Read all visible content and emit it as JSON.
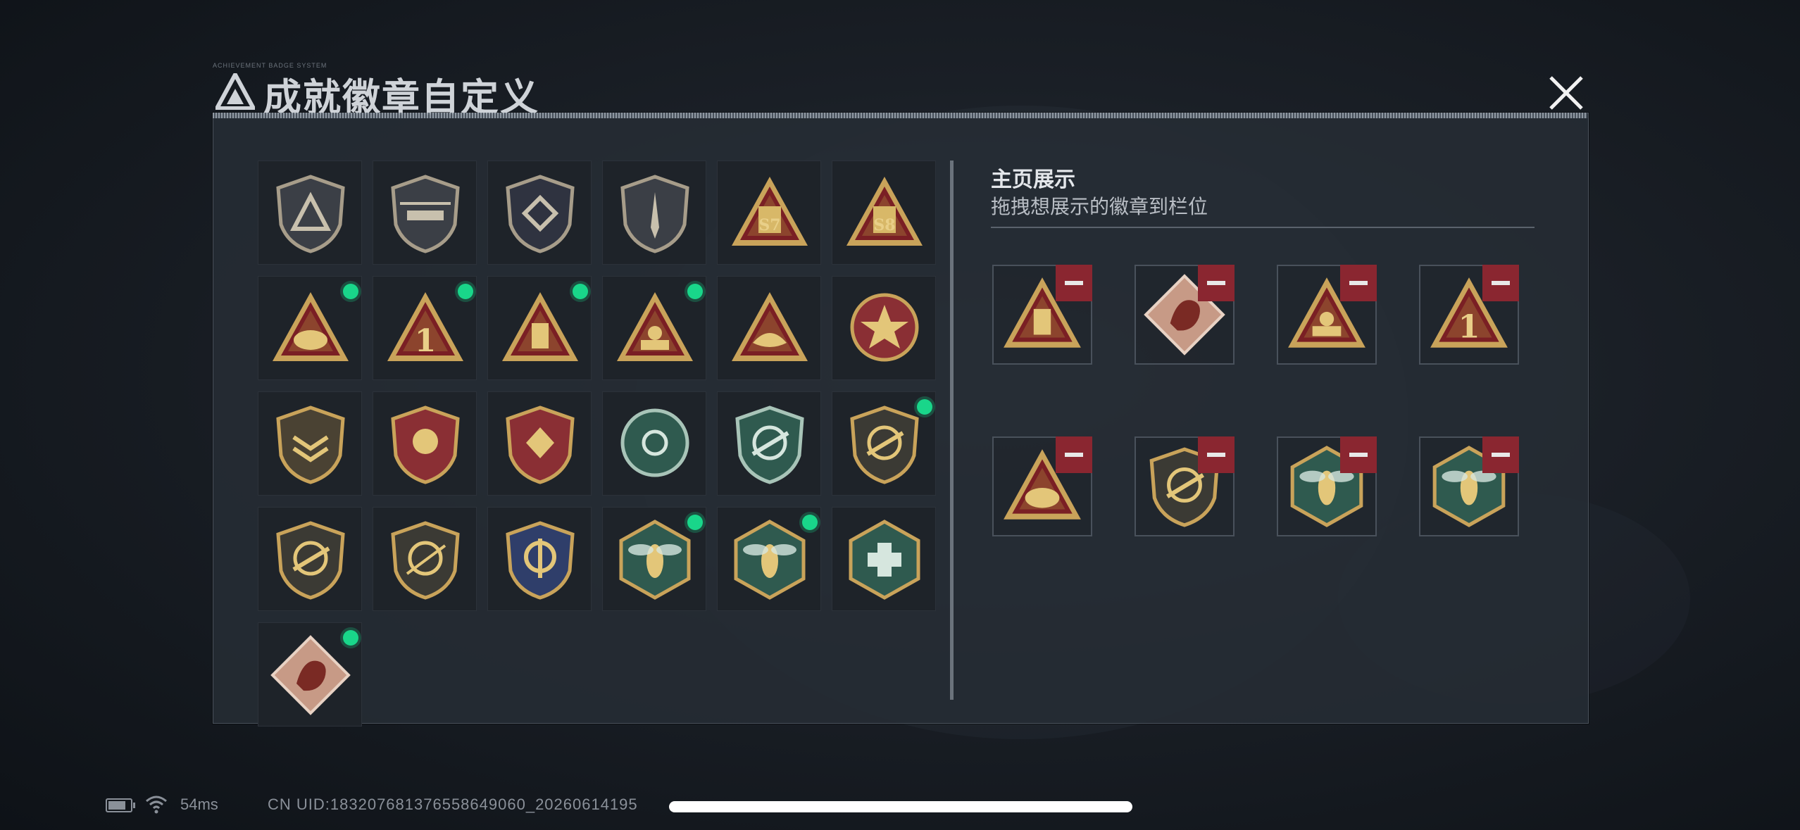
{
  "header": {
    "title": "成就徽章自定义",
    "tiny_label": "ACHIEVEMENT BADGE SYSTEM",
    "close_icon": "close-icon"
  },
  "colors": {
    "new_dot": "#19d68a",
    "remove_button": "#8a2630",
    "panel": "#262c34",
    "gold": "#c9a35a",
    "maroon": "#7a1f24",
    "teal": "#2f5a4f"
  },
  "collection": {
    "badges": [
      {
        "icon": "shield-triangle-badge-icon",
        "new": false
      },
      {
        "icon": "helicopter-shield-badge-icon",
        "new": false
      },
      {
        "icon": "diamond-shield-badge-icon",
        "new": false
      },
      {
        "icon": "dagger-shield-badge-icon",
        "new": false
      },
      {
        "icon": "season-s7-triangle-badge-icon",
        "label": "S7",
        "new": false
      },
      {
        "icon": "season-s8-triangle-badge-icon",
        "label": "S8",
        "new": false
      },
      {
        "icon": "helmet-triangle-badge-icon",
        "new": true
      },
      {
        "icon": "number-one-triangle-badge-icon",
        "label": "1",
        "new": true
      },
      {
        "icon": "usb-triangle-badge-icon",
        "new": true
      },
      {
        "icon": "squad-triangle-badge-icon",
        "new": true
      },
      {
        "icon": "fish-triangle-badge-icon",
        "new": false
      },
      {
        "icon": "star-medal-badge-icon",
        "new": false
      },
      {
        "icon": "chevron-rank-badge-icon",
        "new": false
      },
      {
        "icon": "winged-rank-badge-icon",
        "new": false
      },
      {
        "icon": "diamond-rank-badge-icon",
        "new": false
      },
      {
        "icon": "green-target-badge-icon",
        "new": false
      },
      {
        "icon": "green-rifle-crosshair-badge-icon",
        "new": false
      },
      {
        "icon": "rifle-crosshair-badge-icon",
        "new": true
      },
      {
        "icon": "rifle-crosshair-badge-icon",
        "new": false
      },
      {
        "icon": "sniper-crosshair-badge-icon",
        "new": false
      },
      {
        "icon": "anchor-crest-badge-icon",
        "new": false
      },
      {
        "icon": "wasp-hexagon-badge-icon",
        "new": true
      },
      {
        "icon": "wasp-hexagon-badge-icon",
        "new": true
      },
      {
        "icon": "medic-hexagon-badge-icon",
        "new": false
      },
      {
        "icon": "dragon-diamond-badge-icon",
        "new": true
      }
    ]
  },
  "showcase": {
    "title": "主页展示",
    "subtitle": "拖拽想展示的徽章到栏位",
    "slots": [
      {
        "icon": "usb-triangle-badge-icon"
      },
      {
        "icon": "dragon-diamond-badge-icon"
      },
      {
        "icon": "squad-triangle-badge-icon"
      },
      {
        "icon": "number-one-triangle-badge-icon",
        "label": "1"
      },
      {
        "icon": "helmet-triangle-badge-icon"
      },
      {
        "icon": "rifle-crosshair-badge-icon"
      },
      {
        "icon": "wasp-hexagon-badge-icon"
      },
      {
        "icon": "wasp-hexagon-badge-icon"
      }
    ],
    "remove_icon": "minus-icon"
  },
  "status_bar": {
    "battery_icon": "battery-icon",
    "wifi_icon": "wifi-icon",
    "latency": "54ms",
    "uid": "CN UID:18320768137655864906​0_20260614195"
  }
}
